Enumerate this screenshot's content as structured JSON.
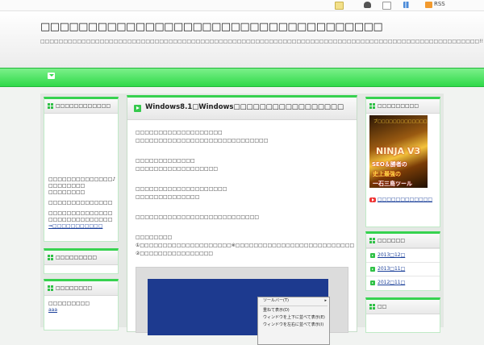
{
  "topbar": {
    "rss_label": "RSS",
    "icons": [
      "edit-icon",
      "user-icon",
      "mail-icon",
      "chart-icon",
      "rss-icon"
    ]
  },
  "header": {
    "site_title": "□□□□□□□□□□□□□□□□□□□□□□□□□□□□□□□□□□□□",
    "description": "□□□□□□□□□□□□□□□□□□□□□□□□□□□□□□□□□□□□□□□□□□□□□□□□□□□□□□□□□□□□□□□□□□□□□□□□□□□□□□□□□□□□□□□□□□□□□□□□!!"
  },
  "nav": {
    "home_icon": "home-icon"
  },
  "left_sidebar": {
    "profile": {
      "title": "□□□□□□□□□□□□",
      "lines": [
        "□□□□□□□□□□□□□□♪",
        "□□□□□□□□",
        "□□□□□□□□",
        "□□□□□□□□□□□□□□",
        "□□□□□□□□□□□□□□",
        "□□□□□□□□□□□□□□"
      ],
      "link": "⇒□□□□□□□□□□□"
    },
    "widget2": {
      "title": "□□□□□□□□□"
    },
    "widget3": {
      "title": "□□□□□□□□",
      "lines": [
        "□□□□□□□□□"
      ],
      "link": "aaa"
    }
  },
  "main": {
    "post_title": "Windows8.1□Windows□□□□□□□□□□□□□□□□□",
    "paragraphs": [
      [
        "□□□□□□□□□□□□□□□□□□□",
        "□□□□□□□□□□□□□□□□□□□□□□□□□□□□□"
      ],
      [
        "□□□□□□□□□□□□□",
        "□□□□□□□□□□□□□□□□□□"
      ],
      [
        "□□□□□□□□□□□□□□□□□□□□",
        "□□□□□□□□□□□□□□"
      ],
      [
        "□□□□□□□□□□□□□□□□□□□□□□□□□□□"
      ],
      [
        "□□□□□□□□",
        "①□□□□□□□□□□□□□□□□□□□□※□□□□□□□□□□□□□□□□□□□□□□□□□□",
        "②□□□□□□□□□□□□□□□□"
      ]
    ],
    "screenshot": {
      "menu_items": [
        "ツールバー(T)",
        "重ねて表示(D)",
        "ウィンドウを上下に並べて表示(E)",
        "ウィンドウを左右に並べて表示(I)"
      ]
    }
  },
  "right_sidebar": {
    "promo": {
      "title": "□□□□□□□□□",
      "banner_text": [
        "ブ□□□□□□□□□□□□□",
        "NINJA V3",
        "SEO＆勝者の",
        "史上最強の",
        "一石三鳥ツール"
      ],
      "link": "□□□□□□□□□□□□"
    },
    "archive": {
      "title": "□□□□□□",
      "items": [
        "2013□12□",
        "2013□11□",
        "2012□11□"
      ]
    },
    "widget3": {
      "title": "□□"
    }
  }
}
